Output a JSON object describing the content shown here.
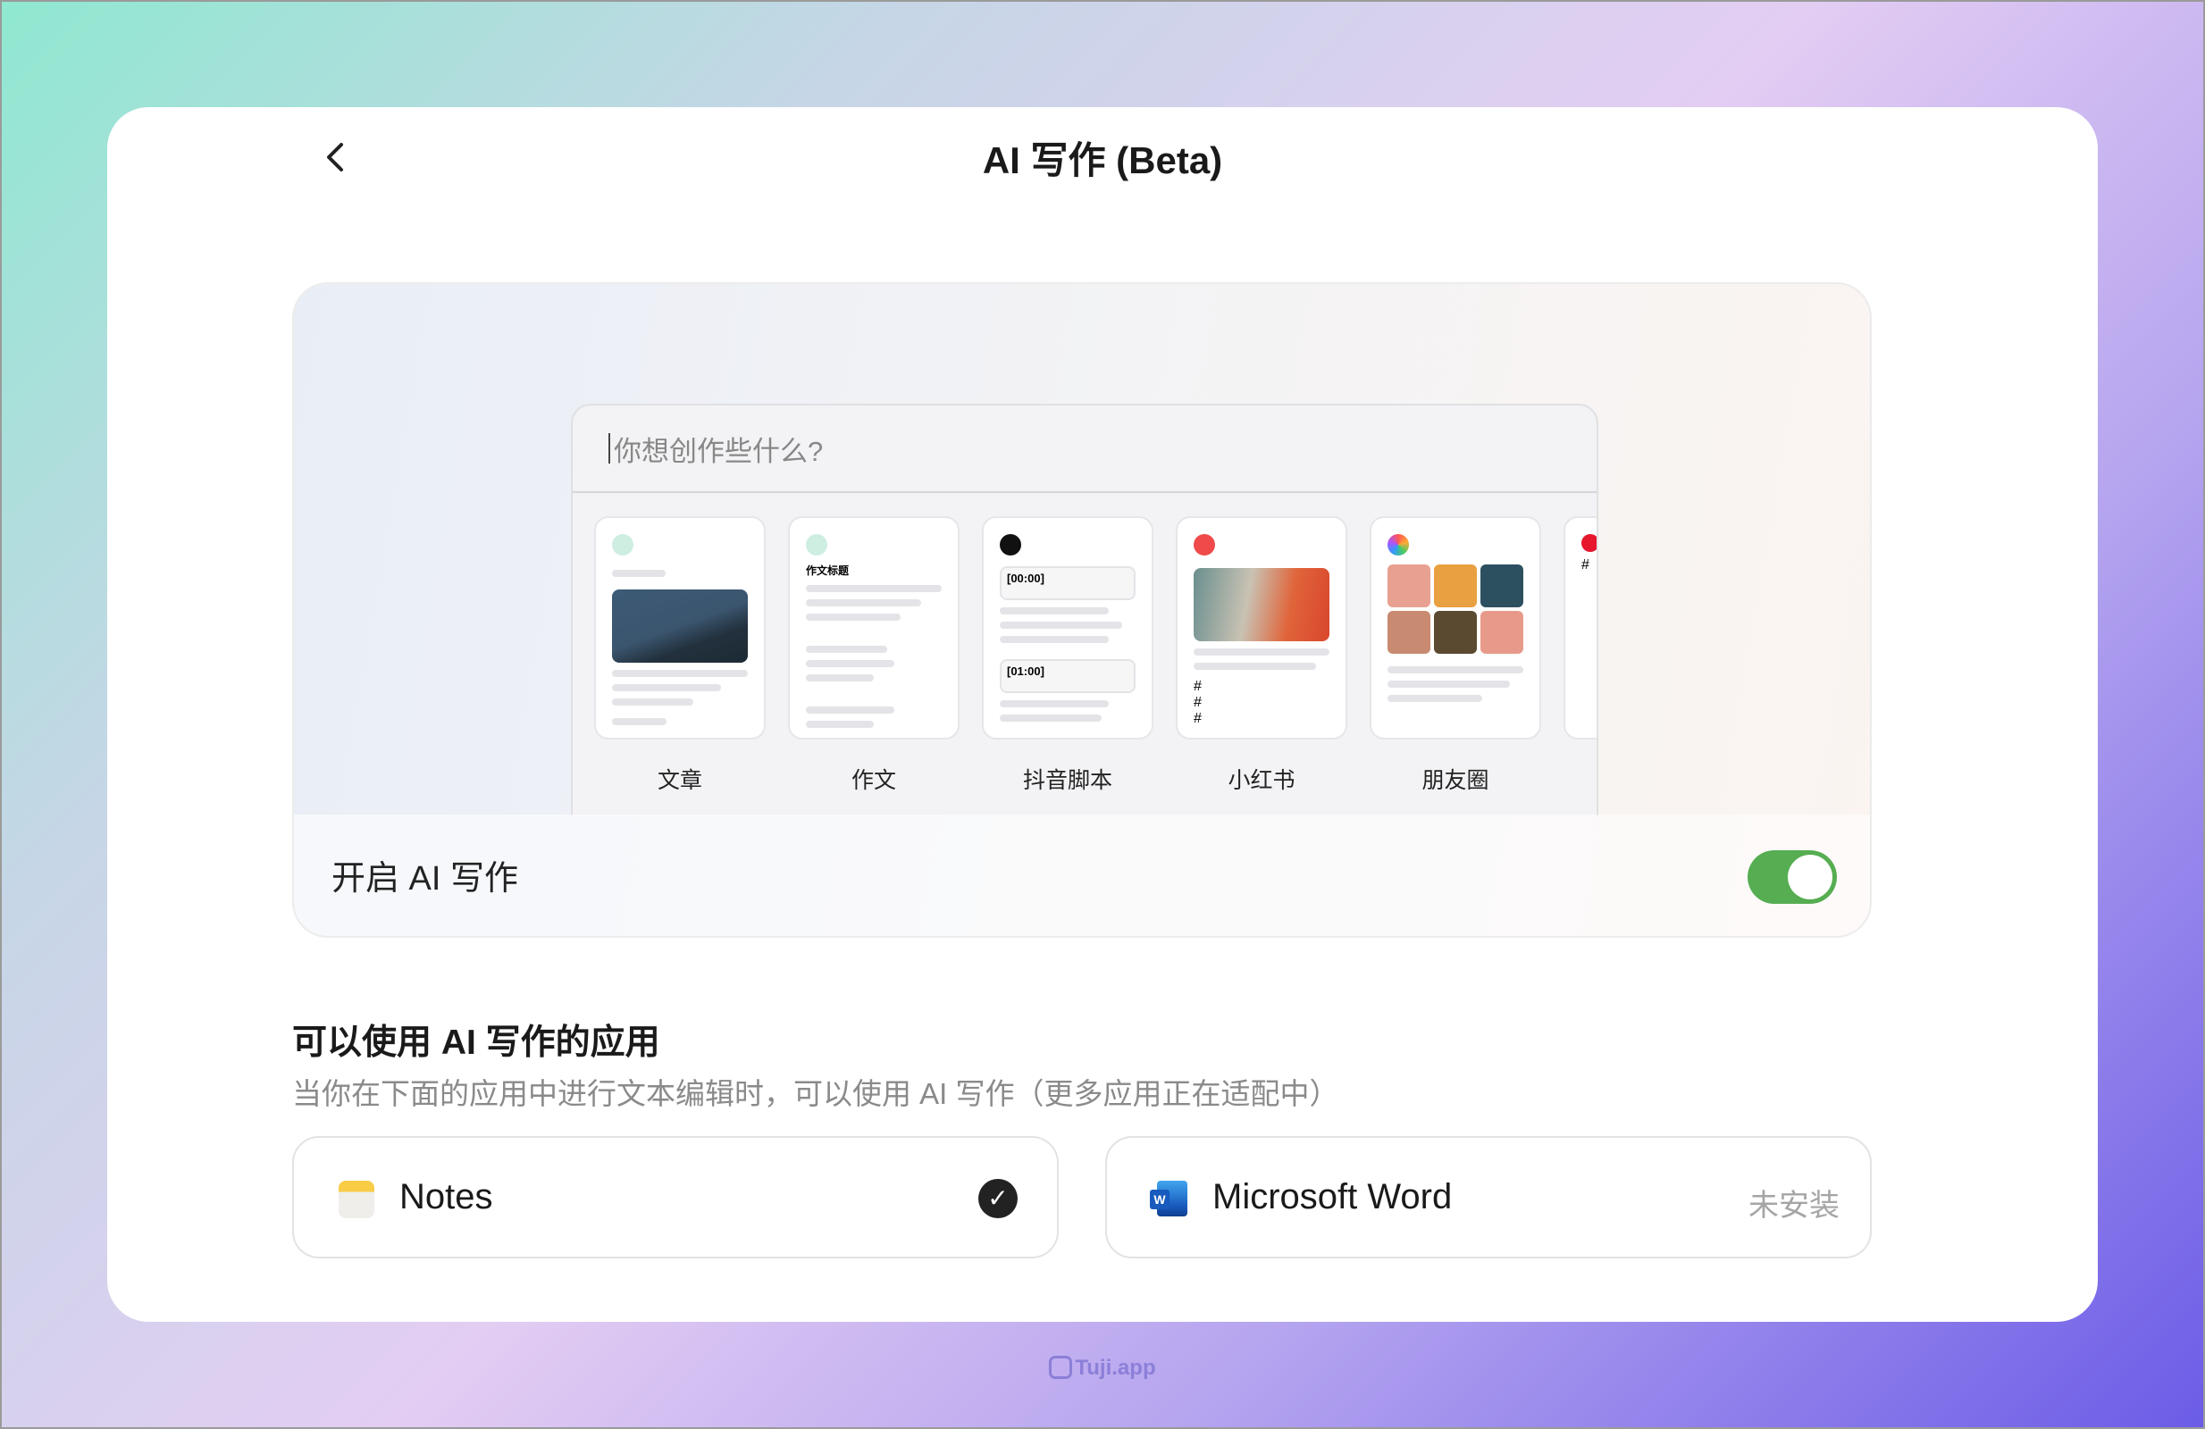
{
  "header": {
    "title": "AI 写作 (Beta)",
    "back_icon": "chevron-left-icon"
  },
  "preview": {
    "placeholder": "你想创作些什么?",
    "templates": [
      {
        "label": "文章",
        "icon": "article-icon",
        "color": "#2e8b57"
      },
      {
        "label": "作文",
        "icon": "pen-icon",
        "color": "#3a9a6a",
        "heading": "作文标题"
      },
      {
        "label": "抖音脚本",
        "icon": "tiktok-icon",
        "color": "#111111",
        "timestamps": [
          "[00:00]",
          "[01:00]"
        ]
      },
      {
        "label": "小红书",
        "icon": "xiaohongshu-icon",
        "color": "#ff2442",
        "hashtag": "#"
      },
      {
        "label": "朋友圈",
        "icon": "moments-icon",
        "color": "#f5a623"
      }
    ],
    "partial_hashtag": "#"
  },
  "toggle": {
    "label": "开启 AI 写作",
    "on": true,
    "color": "#56ad52"
  },
  "apps_section": {
    "title": "可以使用 AI 写作的应用",
    "subtitle": "当你在下面的应用中进行文本编辑时，可以使用 AI 写作（更多应用正在适配中）",
    "apps": [
      {
        "name": "Notes",
        "status_icon": "check-circle-icon",
        "selected": true
      },
      {
        "name": "Microsoft Word",
        "status": "未安装",
        "word_letter": "W"
      }
    ]
  },
  "footer": {
    "watermark": "Tuji.app"
  }
}
